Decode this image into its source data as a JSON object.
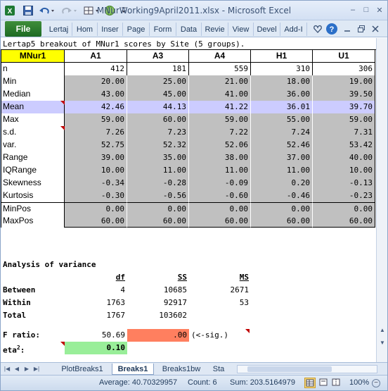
{
  "window": {
    "title": "MNurWorking9April2011.xlsx - Microsoft Excel",
    "minimize": "–",
    "maximize": "□",
    "close": "✕"
  },
  "ribbon": {
    "file_tab": "File",
    "tabs": [
      "Lertap",
      "Home",
      "Insert",
      "Page",
      "Form",
      "Data",
      "Revie",
      "View",
      "Devel",
      "Add-I"
    ],
    "tab_display": [
      "Lertaj",
      "Hom",
      "Inser",
      "Page",
      "Form",
      "Data",
      "Revie",
      "View",
      "Devel",
      "Add-I"
    ]
  },
  "sheet": {
    "heading": "Lertap5 breakout of MNur1 scores by Site (5 groups).",
    "header_row": [
      "MNur1",
      "A1",
      "A3",
      "A4",
      "H1",
      "U1"
    ],
    "stats": [
      {
        "label": "n",
        "values": [
          "412",
          "181",
          "559",
          "310",
          "306"
        ]
      },
      {
        "label": "Min",
        "values": [
          "20.00",
          "25.00",
          "21.00",
          "18.00",
          "19.00"
        ]
      },
      {
        "label": "Median",
        "values": [
          "43.00",
          "45.00",
          "41.00",
          "36.00",
          "39.50"
        ]
      },
      {
        "label": "Mean",
        "values": [
          "42.46",
          "44.13",
          "41.22",
          "36.01",
          "39.70"
        ]
      },
      {
        "label": "Max",
        "values": [
          "59.00",
          "60.00",
          "59.00",
          "55.00",
          "59.00"
        ]
      },
      {
        "label": "s.d.",
        "values": [
          "7.26",
          "7.23",
          "7.22",
          "7.24",
          "7.31"
        ]
      },
      {
        "label": "var.",
        "values": [
          "52.75",
          "52.32",
          "52.06",
          "52.46",
          "53.42"
        ]
      },
      {
        "label": "Range",
        "values": [
          "39.00",
          "35.00",
          "38.00",
          "37.00",
          "40.00"
        ]
      },
      {
        "label": "IQRange",
        "values": [
          "10.00",
          "11.00",
          "11.00",
          "11.00",
          "10.00"
        ]
      },
      {
        "label": "Skewness",
        "values": [
          "-0.34",
          "-0.28",
          "-0.09",
          "0.20",
          "-0.13"
        ]
      },
      {
        "label": "Kurtosis",
        "values": [
          "-0.30",
          "-0.56",
          "-0.60",
          "-0.46",
          "-0.23"
        ]
      },
      {
        "label": "MinPos",
        "values": [
          "0.00",
          "0.00",
          "0.00",
          "0.00",
          "0.00"
        ]
      },
      {
        "label": "MaxPos",
        "values": [
          "60.00",
          "60.00",
          "60.00",
          "60.00",
          "60.00"
        ]
      }
    ],
    "anova": {
      "title": "Analysis of variance",
      "col_headers": [
        "df",
        "SS",
        "MS"
      ],
      "rows": [
        {
          "label": "Between",
          "df": "4",
          "ss": "10685",
          "ms": "2671"
        },
        {
          "label": "Within",
          "df": "1763",
          "ss": "92917",
          "ms": "53"
        },
        {
          "label": "Total",
          "df": "1767",
          "ss": "103602",
          "ms": ""
        }
      ],
      "f_label": "F ratio:",
      "f_value": "50.69",
      "p_value": ".00",
      "sig_note": "(<-sig.)",
      "eta_label": "eta",
      "eta_sup": "2",
      "eta_colon": ":",
      "eta_value": "0.10"
    }
  },
  "sheet_tabs": [
    "PlotBreaks1",
    "Breaks1",
    "Breaks1bw",
    "Sta"
  ],
  "active_tab": "Breaks1",
  "status": {
    "average": "Average: 40.70329957",
    "count": "Count: 6",
    "sum": "Sum: 203.5164979",
    "zoom": "100%"
  },
  "colors": {
    "header_yellow": "#ffff00",
    "grey_cells": "#c0c0c0",
    "mean_row": "#ccccff",
    "p_value_fill": "#ff7f5f",
    "eta_fill": "#99ee99",
    "file_tab": "#2a7a2d"
  }
}
